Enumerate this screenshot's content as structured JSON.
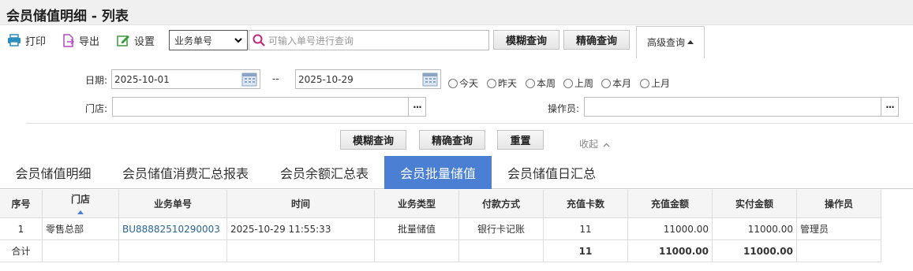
{
  "title": "会员储值明细 - 列表",
  "toolbar": {
    "print": "打印",
    "export": "导出",
    "settings": "设置",
    "search_type": "业务单号",
    "search_placeholder": "可输入单号进行查询",
    "fuzzy_search": "模糊查询",
    "exact_search": "精确查询",
    "advanced_search": "高级查询"
  },
  "filters": {
    "date_label": "日期:",
    "date_from": "2025-10-01",
    "date_sep": "--",
    "date_to": "2025-10-29",
    "quick_ranges": [
      "今天",
      "昨天",
      "本周",
      "上周",
      "本月",
      "上月"
    ],
    "store_label": "门店:",
    "store_value": "",
    "operator_label": "操作员:",
    "operator_value": "",
    "more": "···",
    "fuzzy_search": "模糊查询",
    "exact_search": "精确查询",
    "reset": "重置",
    "collapse": "收起"
  },
  "tabs": [
    "会员储值明细",
    "会员储值消费汇总报表",
    "会员余额汇总表",
    "会员批量储值",
    "会员储值日汇总"
  ],
  "active_tab": 3,
  "table": {
    "headers": [
      "序号",
      "门店",
      "业务单号",
      "时间",
      "业务类型",
      "付款方式",
      "充值卡数",
      "充值金额",
      "实付金额",
      "操作员"
    ],
    "rows": [
      [
        "1",
        "零售总部",
        "BU88882510290003",
        "2025-10-29 11:55:33",
        "批量储值",
        "银行卡记账",
        "11",
        "11000.00",
        "11000.00",
        "管理员"
      ]
    ],
    "total": {
      "label": "合计",
      "card_count": "11",
      "recharge_amount": "11000.00",
      "paid_amount": "11000.00"
    }
  },
  "colors": {
    "accent": "#4a7fd4",
    "link": "#2a6496"
  }
}
